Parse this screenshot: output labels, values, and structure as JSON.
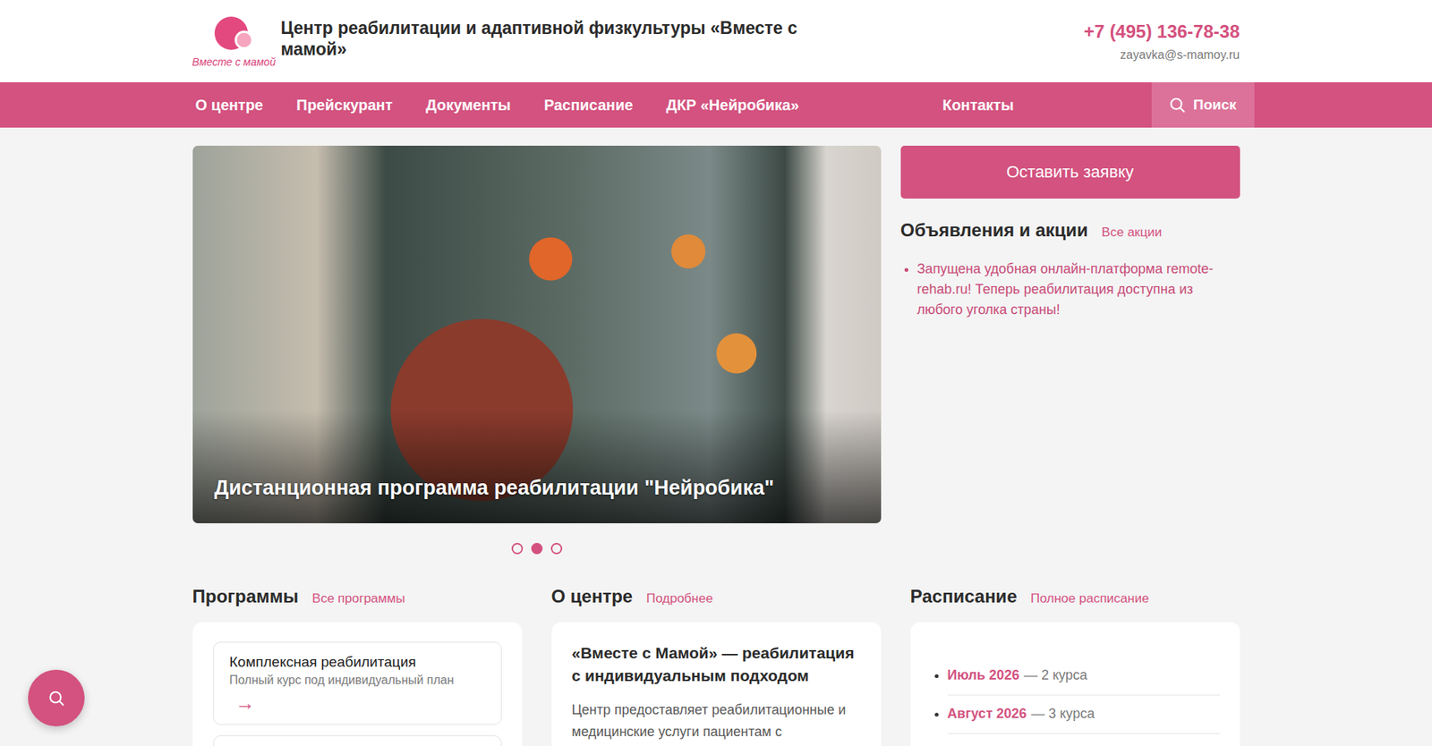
{
  "header": {
    "logo_text": "Вместе с мамой",
    "title": "Центр реабилитации и адаптивной физкультуры «Вместе с мамой»",
    "phone": "+7 (495) 136-78-38",
    "email": "zayavka@s-mamoy.ru"
  },
  "nav": {
    "items": [
      {
        "label": "О центре",
        "selected": false
      },
      {
        "label": "Прейскурант",
        "selected": false
      },
      {
        "label": "Документы",
        "selected": false
      },
      {
        "label": "Расписание",
        "selected": false
      },
      {
        "label": "ДКР «Нейробика»",
        "selected": false
      }
    ],
    "right_item": {
      "label": "Контакты",
      "selected": false
    },
    "search": "Поиск"
  },
  "slider": {
    "caption": "Дистанционная программа реабилитации \"Нейробика\"",
    "dots": [
      {
        "selected": false
      },
      {
        "selected": true
      },
      {
        "selected": false
      }
    ]
  },
  "cta": "Оставить заявку",
  "announcements": {
    "title": "Объявления и акции",
    "link": "Все акции",
    "items": [
      "Запущена удобная онлайн-платформа remote-rehab.ru! Теперь реабилитация доступна из любого уголка страны!"
    ]
  },
  "programs": {
    "title": "Программы",
    "link": "Все программы",
    "items": [
      {
        "name": "Комплексная реабилитация",
        "description": "Полный курс под индивидуальный план",
        "arrow": "→"
      }
    ]
  },
  "about": {
    "title": "О центре",
    "link": "Подробнее",
    "heading": "«Вместе с Мамой» — реабилитация с индивидуальным подходом",
    "text": "Центр предоставляет реабилитационные и медицинские услуги пациентам с"
  },
  "schedule": {
    "title": "Расписание",
    "link": "Полное расписание",
    "items": [
      {
        "month": "Июль 2026",
        "count": "— 2 курса"
      },
      {
        "month": "Август 2026",
        "count": "— 3 курса"
      }
    ]
  }
}
